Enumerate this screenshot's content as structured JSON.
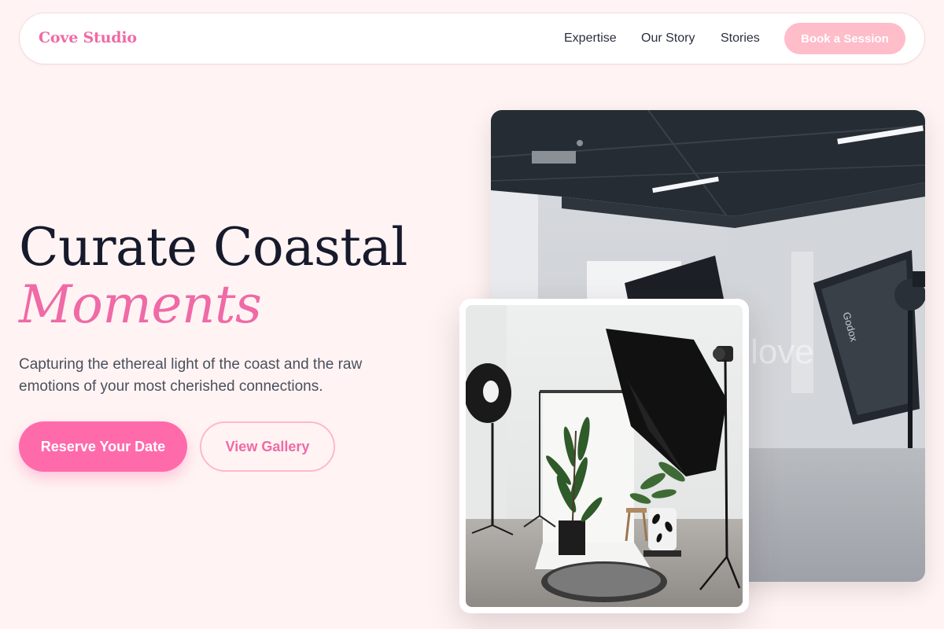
{
  "header": {
    "brand": "Cove Studio",
    "nav": [
      {
        "label": "Expertise"
      },
      {
        "label": "Our Story"
      },
      {
        "label": "Stories"
      }
    ],
    "cta": "Book a Session"
  },
  "hero": {
    "title": "Curate Coastal",
    "accent": "Moments",
    "subtitle": "Capturing the ethereal light of the coast and the raw emotions of your most cherished connections.",
    "primary_button": "Reserve Your Date",
    "secondary_button": "View Gallery"
  },
  "photos": {
    "back_wall_text": "love",
    "softbox_brand": "Godox"
  },
  "colors": {
    "accent": "#ef6aa6",
    "primary_button": "#ff6aab",
    "page_background": "#fff4f3",
    "nav_cta_background": "#ffbcc9"
  }
}
